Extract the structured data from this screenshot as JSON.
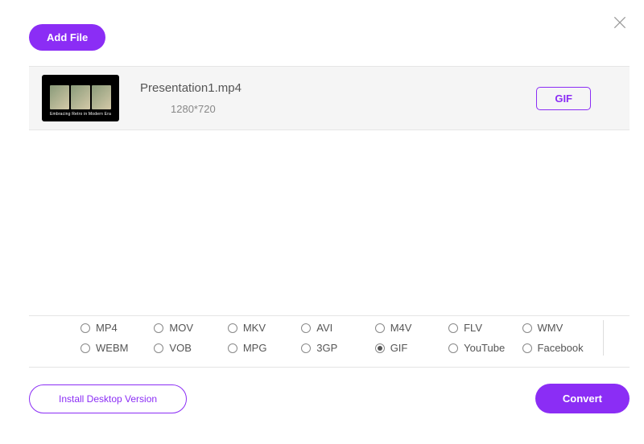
{
  "buttons": {
    "add_file": "Add File",
    "install": "Install Desktop Version",
    "convert": "Convert"
  },
  "file": {
    "name": "Presentation1.mp4",
    "resolution": "1280*720",
    "output_format": "GIF",
    "thumbnail_caption": "Embracing Retro in Modern Era"
  },
  "formats": {
    "row1": [
      {
        "label": "MP4",
        "selected": false
      },
      {
        "label": "MOV",
        "selected": false
      },
      {
        "label": "MKV",
        "selected": false
      },
      {
        "label": "AVI",
        "selected": false
      },
      {
        "label": "M4V",
        "selected": false
      },
      {
        "label": "FLV",
        "selected": false
      },
      {
        "label": "WMV",
        "selected": false
      }
    ],
    "row2": [
      {
        "label": "WEBM",
        "selected": false
      },
      {
        "label": "VOB",
        "selected": false
      },
      {
        "label": "MPG",
        "selected": false
      },
      {
        "label": "3GP",
        "selected": false
      },
      {
        "label": "GIF",
        "selected": true
      },
      {
        "label": "YouTube",
        "selected": false
      },
      {
        "label": "Facebook",
        "selected": false
      }
    ]
  },
  "colors": {
    "accent": "#8b2df5"
  }
}
